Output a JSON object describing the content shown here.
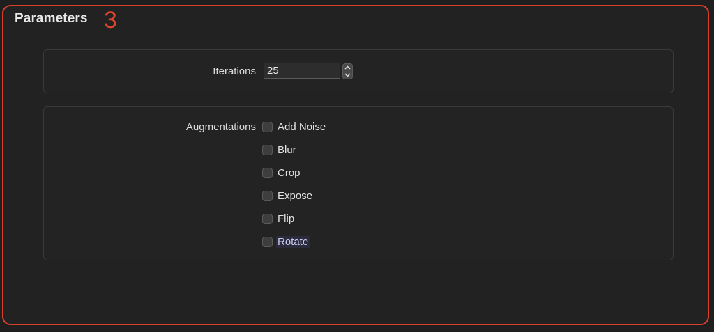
{
  "panel": {
    "title": "Parameters",
    "annotation_number": "3",
    "accent_color": "#d8402a"
  },
  "iterations": {
    "label": "Iterations",
    "value": "25",
    "stepper_icons": [
      "chevron-up-icon",
      "chevron-down-icon"
    ]
  },
  "augmentations": {
    "label": "Augmentations",
    "options": [
      {
        "label": "Add Noise",
        "checked": false
      },
      {
        "label": "Blur",
        "checked": false
      },
      {
        "label": "Crop",
        "checked": false
      },
      {
        "label": "Expose",
        "checked": false
      },
      {
        "label": "Flip",
        "checked": false
      },
      {
        "label": "Rotate",
        "checked": false,
        "focused": true
      }
    ]
  }
}
